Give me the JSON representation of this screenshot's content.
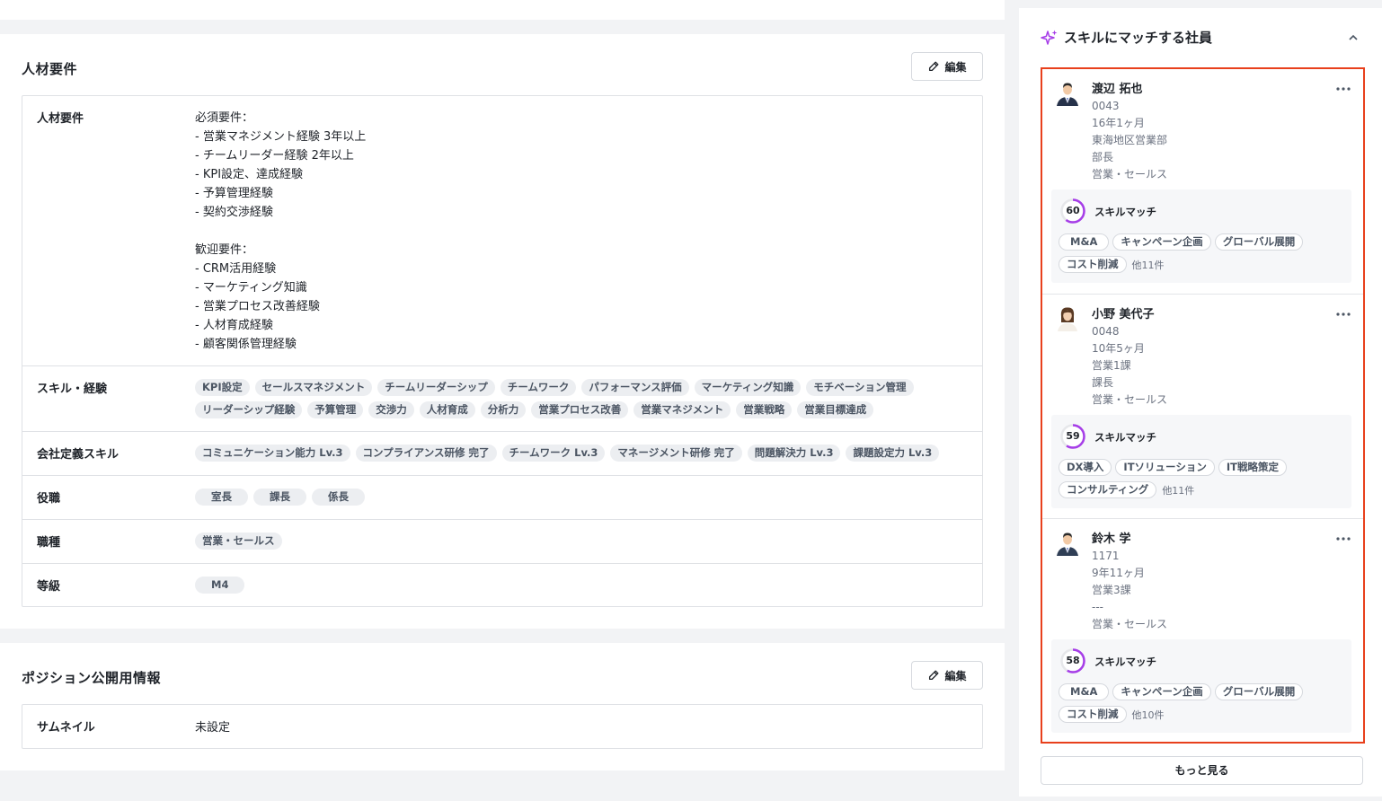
{
  "requirements_card": {
    "title": "人材要件",
    "edit_label": "編集",
    "rows": {
      "requirements": {
        "label": "人材要件",
        "lines": [
          "必須要件：",
          "- 営業マネジメント経験 3年以上",
          "- チームリーダー経験 2年以上",
          "- KPI設定、達成経験",
          "- 予算管理経験",
          "- 契約交渉経験",
          "",
          "歓迎要件：",
          "- CRM活用経験",
          "- マーケティング知識",
          "- 営業プロセス改善経験",
          "- 人材育成経験",
          "- 顧客関係管理経験"
        ]
      },
      "skills": {
        "label": "スキル・経験",
        "tags": [
          "KPI設定",
          "セールスマネジメント",
          "チームリーダーシップ",
          "チームワーク",
          "パフォーマンス評価",
          "マーケティング知識",
          "モチベーション管理",
          "リーダーシップ経験",
          "予算管理",
          "交渉力",
          "人材育成",
          "分析力",
          "営業プロセス改善",
          "営業マネジメント",
          "営業戦略",
          "営業目標達成"
        ]
      },
      "company_skills": {
        "label": "会社定義スキル",
        "tags": [
          "コミュニケーション能力 Lv.3",
          "コンプライアンス研修 完了",
          "チームワーク Lv.3",
          "マネージメント研修 完了",
          "問題解決力 Lv.3",
          "課題設定力 Lv.3"
        ]
      },
      "position": {
        "label": "役職",
        "tags": [
          "室長",
          "課長",
          "係長"
        ]
      },
      "job_type": {
        "label": "職種",
        "tags": [
          "営業・セールス"
        ]
      },
      "grade": {
        "label": "等級",
        "tags": [
          "M4"
        ]
      }
    }
  },
  "position_card": {
    "title": "ポジション公開用情報",
    "edit_label": "編集",
    "thumbnail_label": "サムネイル",
    "thumbnail_value": "未設定"
  },
  "side_panel": {
    "title": "スキルにマッチする社員",
    "more_button": "もっと見る",
    "score_label": "スキルマッチ",
    "accent_color": "#a63de8",
    "highlight_color": "#e8401c",
    "people": [
      {
        "name": "渡辺 拓也",
        "id": "0043",
        "tenure": "16年1ヶ月",
        "department": "東海地区営業部",
        "title": "部長",
        "job": "営業・セールス",
        "score": 60,
        "skills": [
          "M&A",
          "キャンペーン企画",
          "グローバル展開",
          "コスト削減"
        ],
        "others": "他11件"
      },
      {
        "name": "小野 美代子",
        "id": "0048",
        "tenure": "10年5ヶ月",
        "department": "営業1課",
        "title": "課長",
        "job": "営業・セールス",
        "score": 59,
        "skills": [
          "DX導入",
          "ITソリューション",
          "IT戦略策定",
          "コンサルティング"
        ],
        "others": "他11件"
      },
      {
        "name": "鈴木 学",
        "id": "1171",
        "tenure": "9年11ヶ月",
        "department": "営業3課",
        "title": "---",
        "job": "営業・セールス",
        "score": 58,
        "skills": [
          "M&A",
          "キャンペーン企画",
          "グローバル展開",
          "コスト削減"
        ],
        "others": "他10件"
      }
    ]
  }
}
